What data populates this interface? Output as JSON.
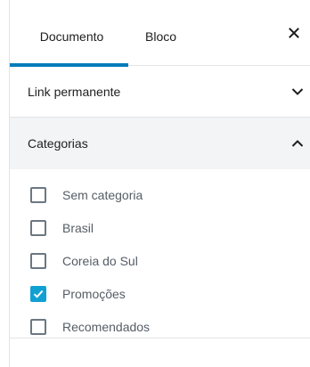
{
  "tabs": {
    "document": "Documento",
    "block": "Bloco",
    "close_icon": "close-icon"
  },
  "permalink_section": {
    "title": "Link permanente",
    "icon": "chevron-down-icon"
  },
  "categories_section": {
    "title": "Categorias",
    "icon": "chevron-up-icon",
    "items": [
      {
        "label": "Sem categoria",
        "checked": false
      },
      {
        "label": "Brasil",
        "checked": false
      },
      {
        "label": "Coreia do Sul",
        "checked": false
      },
      {
        "label": "Promoções",
        "checked": true
      },
      {
        "label": "Recomendados",
        "checked": false
      }
    ]
  },
  "colors": {
    "accent": "#007cba",
    "checkbox_checked": "#11a0d2"
  }
}
